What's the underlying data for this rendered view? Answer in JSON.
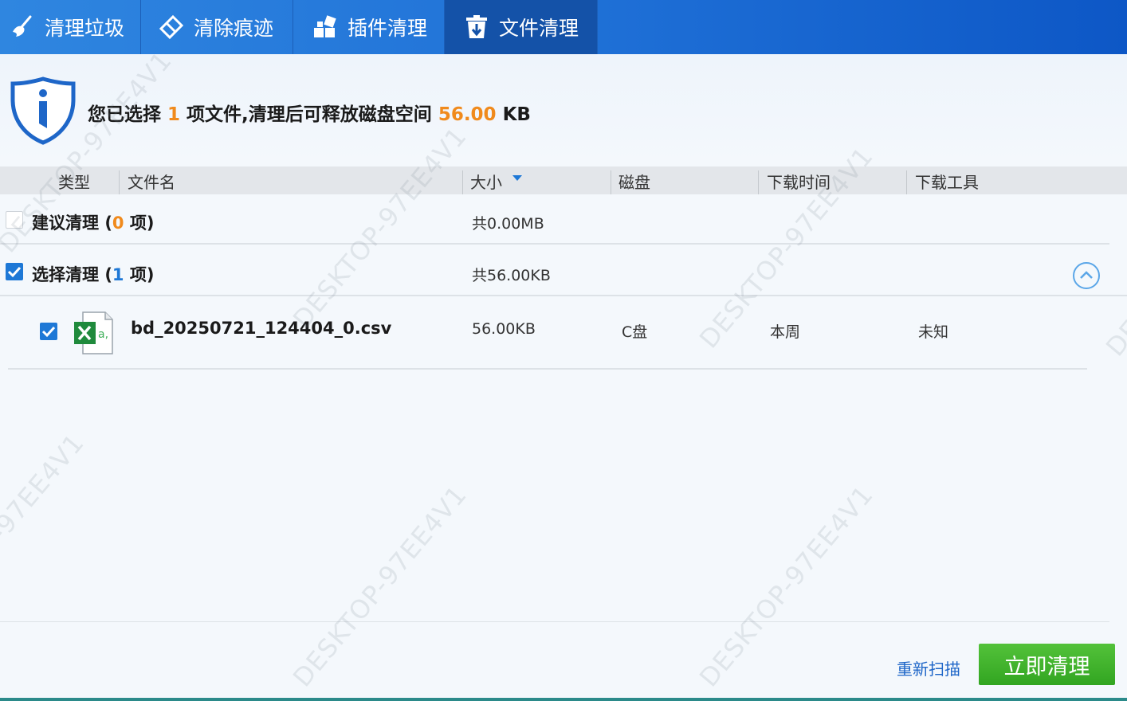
{
  "tabs": [
    {
      "label": "清理垃圾",
      "icon": "broom-icon",
      "active": false
    },
    {
      "label": "清除痕迹",
      "icon": "eraser-icon",
      "active": false
    },
    {
      "label": "插件清理",
      "icon": "plugin-icon",
      "active": false
    },
    {
      "label": "文件清理",
      "icon": "trash-download-icon",
      "active": true
    }
  ],
  "summary": {
    "prefix": "您已选择",
    "count": "1",
    "middle": "项文件,清理后可释放磁盘空间",
    "size": "56.00",
    "unit": "KB"
  },
  "columns": {
    "type": "类型",
    "filename": "文件名",
    "size": "大小",
    "disk": "磁盘",
    "download_time": "下载时间",
    "download_tool": "下载工具"
  },
  "groups": [
    {
      "label": "建议清理",
      "open_paren": "(",
      "count": "0",
      "count_suffix": "项)",
      "total": "共0.00MB",
      "checked": false
    },
    {
      "label": "选择清理",
      "open_paren": "(",
      "count": "1",
      "count_suffix": "项)",
      "total": "共56.00KB",
      "checked": true
    }
  ],
  "files": [
    {
      "name": "bd_20250721_124404_0.csv",
      "size": "56.00KB",
      "disk": "C盘",
      "time": "本周",
      "tool": "未知",
      "checked": true,
      "icon": "excel-file-icon"
    }
  ],
  "actions": {
    "rescan": "重新扫描",
    "clean_now": "立即清理"
  },
  "watermark": "DESKTOP-97EE4V1",
  "colors": {
    "accent_blue": "#1e78d6",
    "highlight_orange": "#f08a1c",
    "clean_button_green": "#3cb12a"
  }
}
